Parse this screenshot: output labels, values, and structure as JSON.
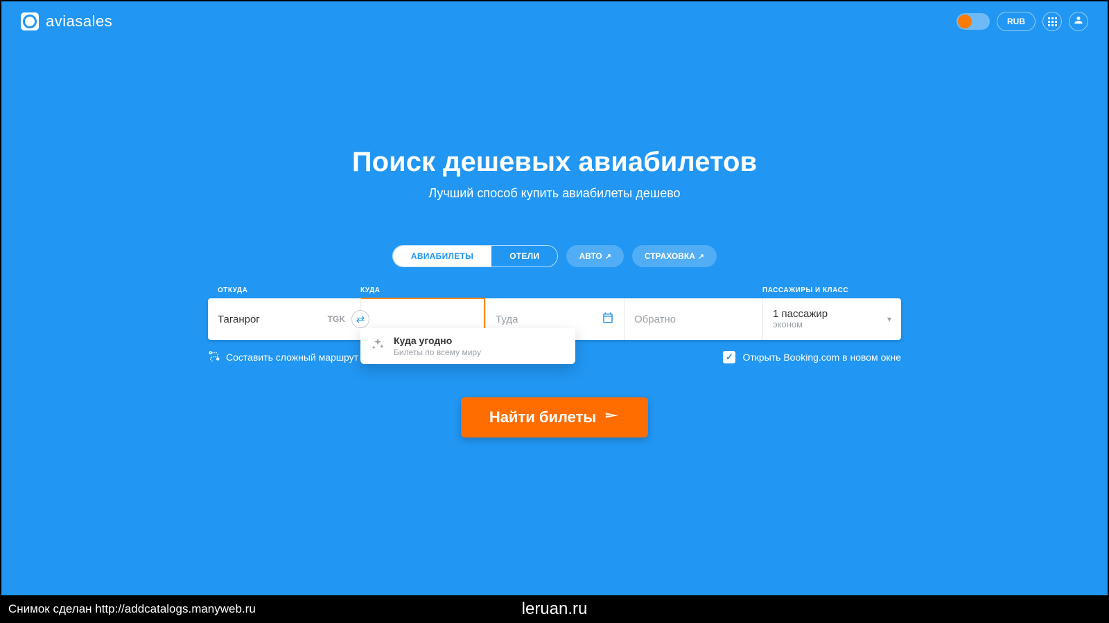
{
  "brand": {
    "name": "aviasales"
  },
  "header": {
    "currency": "RUB"
  },
  "hero": {
    "title": "Поиск дешевых авиабилетов",
    "subtitle": "Лучший способ купить авиабилеты дешево"
  },
  "tabs": {
    "flights": "АВИАБИЛЕТЫ",
    "hotels": "ОТЕЛИ",
    "cars": "АВТО",
    "insurance": "СТРАХОВКА"
  },
  "labels": {
    "from": "ОТКУДА",
    "to": "КУДА",
    "pax": "ПАССАЖИРЫ И КЛАСС"
  },
  "form": {
    "origin_value": "Таганрог",
    "origin_code": "TGK",
    "destination_placeholder": "",
    "depart_placeholder": "Туда",
    "return_placeholder": "Обратно",
    "pax_main": "1 пассажир",
    "pax_sub": "эконом"
  },
  "dropdown": {
    "title": "Куда угодно",
    "subtitle": "Билеты по всему миру"
  },
  "under": {
    "multi": "Составить сложный маршрут",
    "booking": "Открыть Booking.com в новом окне"
  },
  "search_button": "Найти билеты",
  "footer": {
    "left": "Снимок сделан http://addcatalogs.manyweb.ru",
    "center": "leruan.ru"
  }
}
